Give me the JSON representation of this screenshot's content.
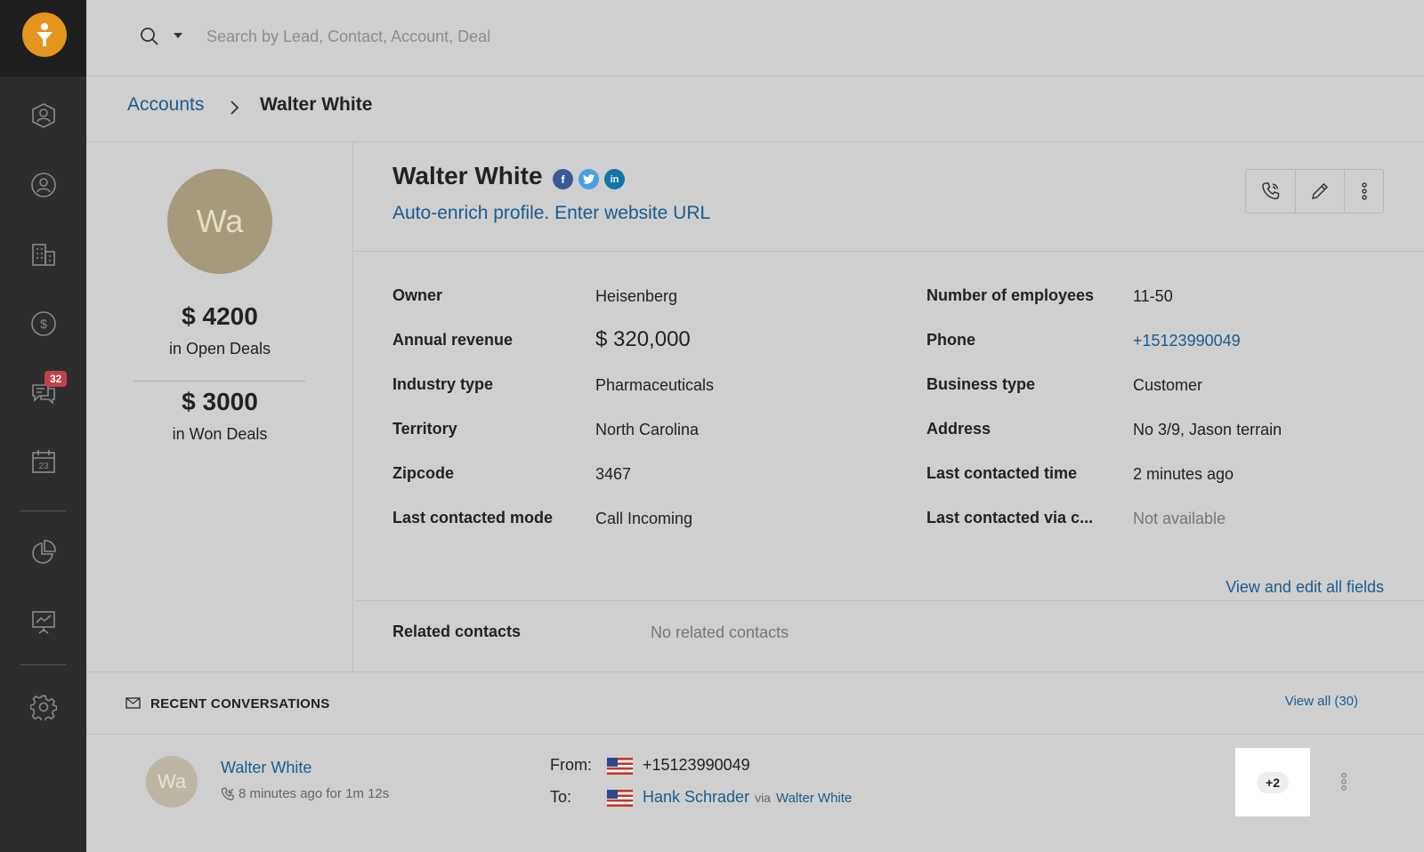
{
  "search": {
    "placeholder": "Search by Lead, Contact, Account, Deal"
  },
  "sidebar": {
    "items": [
      {
        "icon": "leads-icon"
      },
      {
        "icon": "contacts-icon"
      },
      {
        "icon": "accounts-icon"
      },
      {
        "icon": "deals-icon"
      },
      {
        "icon": "conversations-icon",
        "badge": "32"
      },
      {
        "icon": "calendar-icon"
      },
      {
        "icon": "reports-icon"
      },
      {
        "icon": "analytics-icon"
      },
      {
        "icon": "settings-icon"
      }
    ]
  },
  "breadcrumb": {
    "parent": "Accounts",
    "current": "Walter White"
  },
  "summary": {
    "avatar_initials": "Wa",
    "open_deals_amount": "$ 4200",
    "open_deals_label": "in Open Deals",
    "won_deals_amount": "$ 3000",
    "won_deals_label": "in Won Deals"
  },
  "profile": {
    "name": "Walter White",
    "enrich_link": "Auto-enrich profile. Enter website URL",
    "social": {
      "facebook": "f",
      "twitter": "t",
      "linkedin": "in"
    }
  },
  "fields": {
    "left": [
      {
        "label": "Owner",
        "value": "Heisenberg"
      },
      {
        "label": "Annual revenue",
        "value": "$ 320,000"
      },
      {
        "label": "Industry type",
        "value": "Pharmaceuticals"
      },
      {
        "label": "Territory",
        "value": "North Carolina"
      },
      {
        "label": "Zipcode",
        "value": "3467"
      },
      {
        "label": "Last contacted mode",
        "value": "Call Incoming"
      }
    ],
    "right": [
      {
        "label": "Number of employees",
        "value": "11-50"
      },
      {
        "label": "Phone",
        "value": "+15123990049"
      },
      {
        "label": "Business type",
        "value": "Customer"
      },
      {
        "label": "Address",
        "value": "No 3/9, Jason terrain"
      },
      {
        "label": "Last contacted time",
        "value": "2 minutes ago"
      },
      {
        "label": "Last contacted via c...",
        "value": "Not available"
      }
    ],
    "view_edit_link": "View and edit all fields"
  },
  "related": {
    "label": "Related contacts",
    "value": "No related contacts"
  },
  "conversations": {
    "title": "RECENT CONVERSATIONS",
    "view_all": "View all (30)",
    "items": [
      {
        "avatar_initials": "Wa",
        "name": "Walter White",
        "meta": "8 minutes ago for 1m 12s",
        "from_label": "From:",
        "from_number": "+15123990049",
        "to_label": "To:",
        "to_name": "Hank Schrader",
        "via_label": "via",
        "via_name": "Walter White",
        "more_count": "+2"
      }
    ]
  },
  "colors": {
    "accent": "#1a5c8e",
    "brand": "#e3951d",
    "sidebar": "#2d2d2d",
    "badge": "#c0414b"
  }
}
